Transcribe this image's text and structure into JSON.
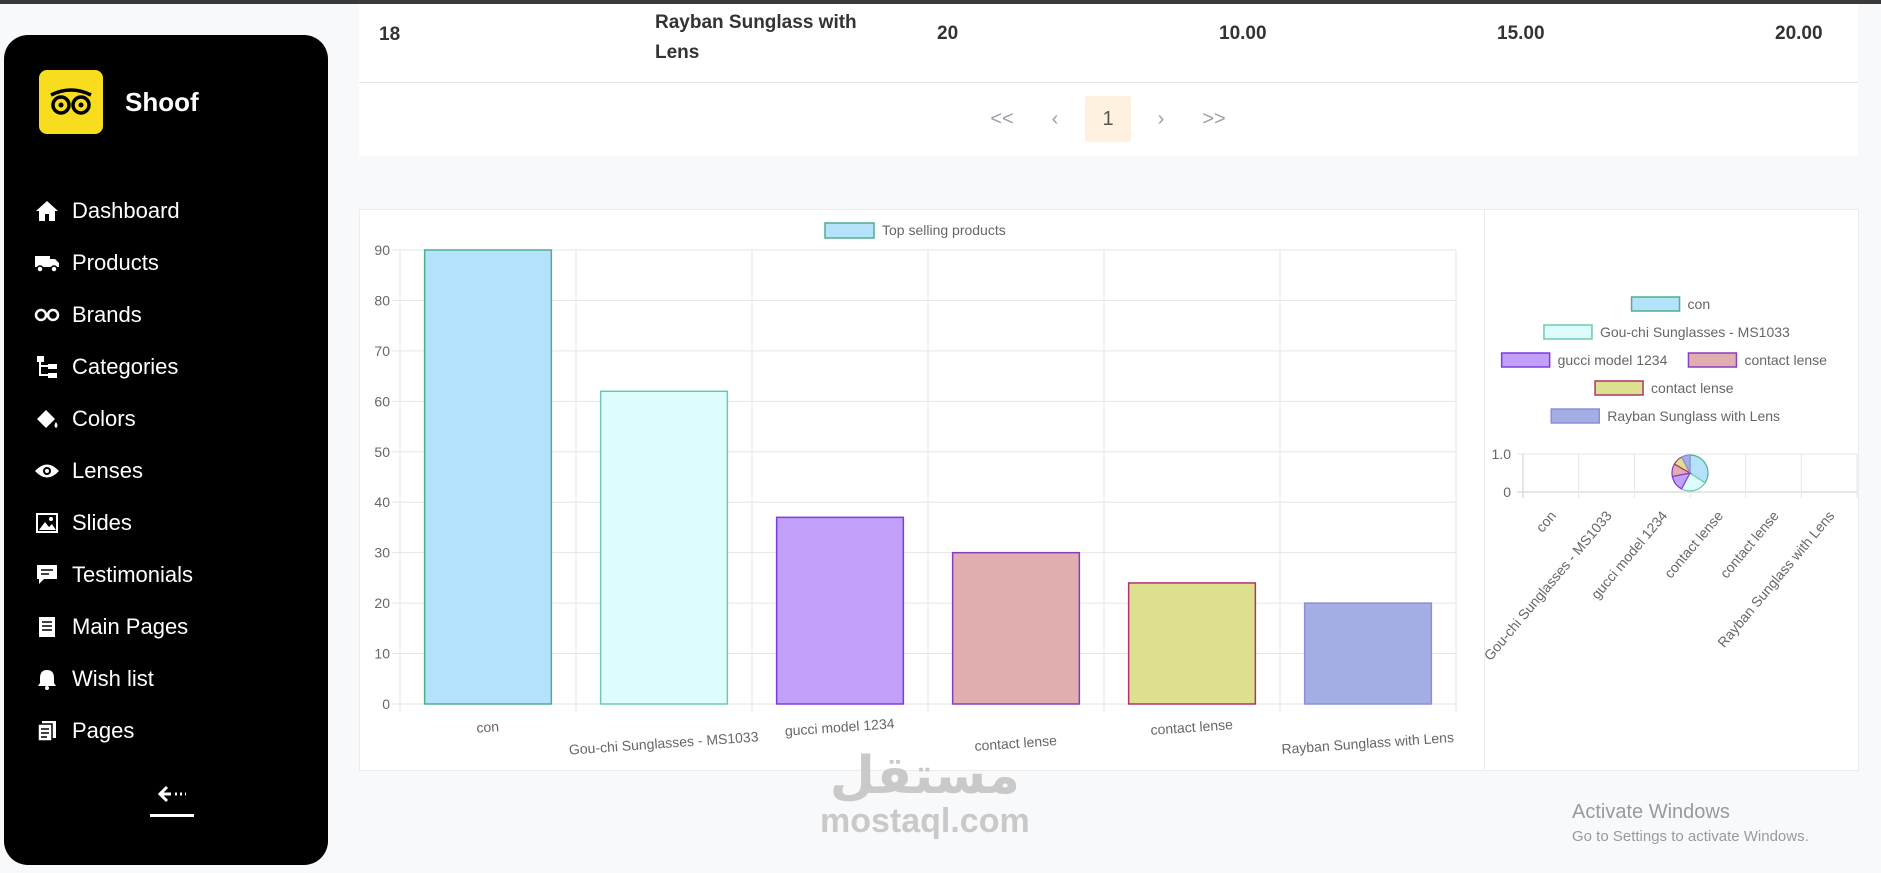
{
  "app": {
    "name": "Shoof"
  },
  "sidebar": {
    "items": [
      {
        "label": "Dashboard",
        "icon": "home-icon"
      },
      {
        "label": "Products",
        "icon": "truck-icon"
      },
      {
        "label": "Brands",
        "icon": "glasses-icon"
      },
      {
        "label": "Categories",
        "icon": "hierarchy-icon"
      },
      {
        "label": "Colors",
        "icon": "paint-bucket-icon"
      },
      {
        "label": "Lenses",
        "icon": "eye-icon"
      },
      {
        "label": "Slides",
        "icon": "image-icon"
      },
      {
        "label": "Testimonials",
        "icon": "comment-icon"
      },
      {
        "label": "Main Pages",
        "icon": "document-icon"
      },
      {
        "label": "Wish list",
        "icon": "bell-icon"
      },
      {
        "label": "Pages",
        "icon": "pages-icon"
      }
    ],
    "collapse_icon": "collapse-arrow-icon"
  },
  "table": {
    "row": {
      "id": "18",
      "name": "Rayban Sunglass with Lens",
      "qty": "20",
      "col4": "10.00",
      "col5": "15.00",
      "col6": "20.00"
    }
  },
  "pagination": {
    "first": "<<",
    "prev": "‹",
    "current": "1",
    "next": "›",
    "last": ">>"
  },
  "chart_data": [
    {
      "type": "bar",
      "legend": [
        "Top selling products"
      ],
      "categories": [
        "con",
        "Gou-chi Sunglasses - MS1033",
        "gucci model 1234",
        "contact lense",
        "contact lense",
        "Rayban Sunglass with Lens"
      ],
      "series": [
        {
          "name": "Top selling products",
          "values": [
            90,
            62,
            37,
            30,
            24,
            20
          ]
        }
      ],
      "ylim": [
        0,
        90
      ],
      "yticks": [
        0,
        10,
        20,
        30,
        40,
        50,
        60,
        70,
        80,
        90
      ],
      "grid": true,
      "colors": [
        "#b3e2fa",
        "#dcfdfb",
        "#c29ff9",
        "#e0aeae",
        "#dde08e",
        "#a4ade4"
      ],
      "borders": [
        "#4fae8e",
        "#6ec9b0",
        "#7a3de0",
        "#8b3dc0",
        "#b0336d",
        "#8890d8"
      ]
    },
    {
      "type": "pie",
      "legend": [
        "con",
        "Gou-chi Sunglasses - MS1033",
        "gucci model 1234",
        "contact lense",
        "contact lense",
        "Rayban Sunglass with Lens"
      ],
      "values": [
        90,
        62,
        37,
        30,
        24,
        20
      ],
      "axis_ticks": [
        "1.0",
        "0"
      ],
      "x_labels": [
        "con",
        "Gou-chi Sunglasses - MS1033",
        "gucci model 1234",
        "contact lense",
        "contact lense",
        "Rayban Sunglass with Lens"
      ],
      "colors": [
        "#b3e2fa",
        "#dcfdfb",
        "#c29ff9",
        "#e0aeae",
        "#dde08e",
        "#a4ade4"
      ],
      "borders": [
        "#4fae8e",
        "#6ec9b0",
        "#7a3de0",
        "#8b3dc0",
        "#b0336d",
        "#8890d8"
      ]
    }
  ],
  "watermark": {
    "mostaql_ar": "مستقل",
    "mostaql_en": "mostaql.com",
    "activate_title": "Activate Windows",
    "activate_sub": "Go to Settings to activate Windows."
  }
}
